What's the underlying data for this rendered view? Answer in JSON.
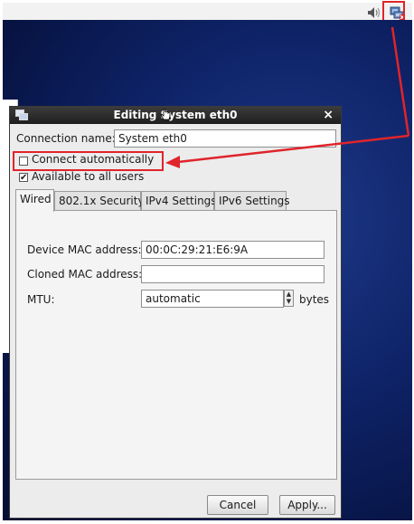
{
  "dialog": {
    "title": "Editing System eth0",
    "close_glyph": "×",
    "connection_name_label": "Connection name:",
    "connection_name_value": "System eth0",
    "connect_automatically_label": "Connect automatically",
    "connect_automatically_checked": false,
    "available_to_all_users_label": "Available to all users",
    "available_to_all_users_checked": true
  },
  "tabs": [
    {
      "label": "Wired",
      "active": true
    },
    {
      "label": "802.1x Security",
      "active": false
    },
    {
      "label": "IPv4 Settings",
      "active": false
    },
    {
      "label": "IPv6 Settings",
      "active": false
    }
  ],
  "wired": {
    "device_mac_label": "Device MAC address:",
    "device_mac_value": "00:0C:29:21:E6:9A",
    "cloned_mac_label": "Cloned MAC address:",
    "cloned_mac_value": "",
    "mtu_label": "MTU:",
    "mtu_value": "automatic",
    "mtu_unit": "bytes"
  },
  "buttons": {
    "cancel": "Cancel",
    "apply": "Apply..."
  },
  "icons": {
    "panel": [
      "speaker-icon",
      "network-disconnected-icon"
    ],
    "annotation_color": "#e0242b"
  }
}
